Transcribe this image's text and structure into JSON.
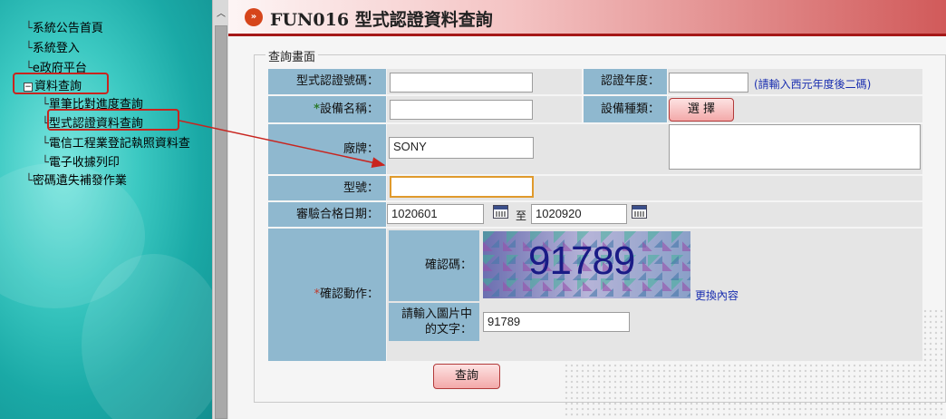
{
  "sidebar": {
    "items": [
      {
        "label": "系統公告首頁"
      },
      {
        "label": "系統登入"
      },
      {
        "label": "e政府平台"
      },
      {
        "label": "資料查詢"
      },
      {
        "label": "單筆比對進度查詢"
      },
      {
        "label": "型式認證資料查詢"
      },
      {
        "label": "電信工程業登記執照資料查"
      },
      {
        "label": "電子收據列印"
      },
      {
        "label": "密碼遺失補發作業"
      }
    ]
  },
  "header": {
    "title": "FUN016 型式認證資料查詢"
  },
  "form": {
    "legend": "查詢畫面",
    "cert_no_label": "型式認證號碼：",
    "cert_year_label": "認證年度：",
    "cert_year_note": "(請輸入西元年度後二碼)",
    "device_name_label": "設備名稱：",
    "device_type_label": "設備種類：",
    "select_button": "選 擇",
    "brand_label": "廠牌：",
    "brand_value": "SONY",
    "model_label": "型號：",
    "model_value": "",
    "date_label": "審驗合格日期：",
    "date_from": "1020601",
    "date_to_sep": "至",
    "date_to": "1020920",
    "confirm_label": "確認動作：",
    "captcha_label": "確認碼：",
    "captcha_image_text": "91789",
    "refresh_link": "更換內容",
    "captcha_input_label_line1": "請輸入圖片中",
    "captcha_input_label_line2": "的文字：",
    "captcha_input_value": "91789",
    "submit_button": "查詢"
  },
  "colors": {
    "label_bg": "#8fb8cf",
    "field_bg": "#e5e5e5",
    "highlight": "#c8251f",
    "accent_title": "#a51818"
  }
}
